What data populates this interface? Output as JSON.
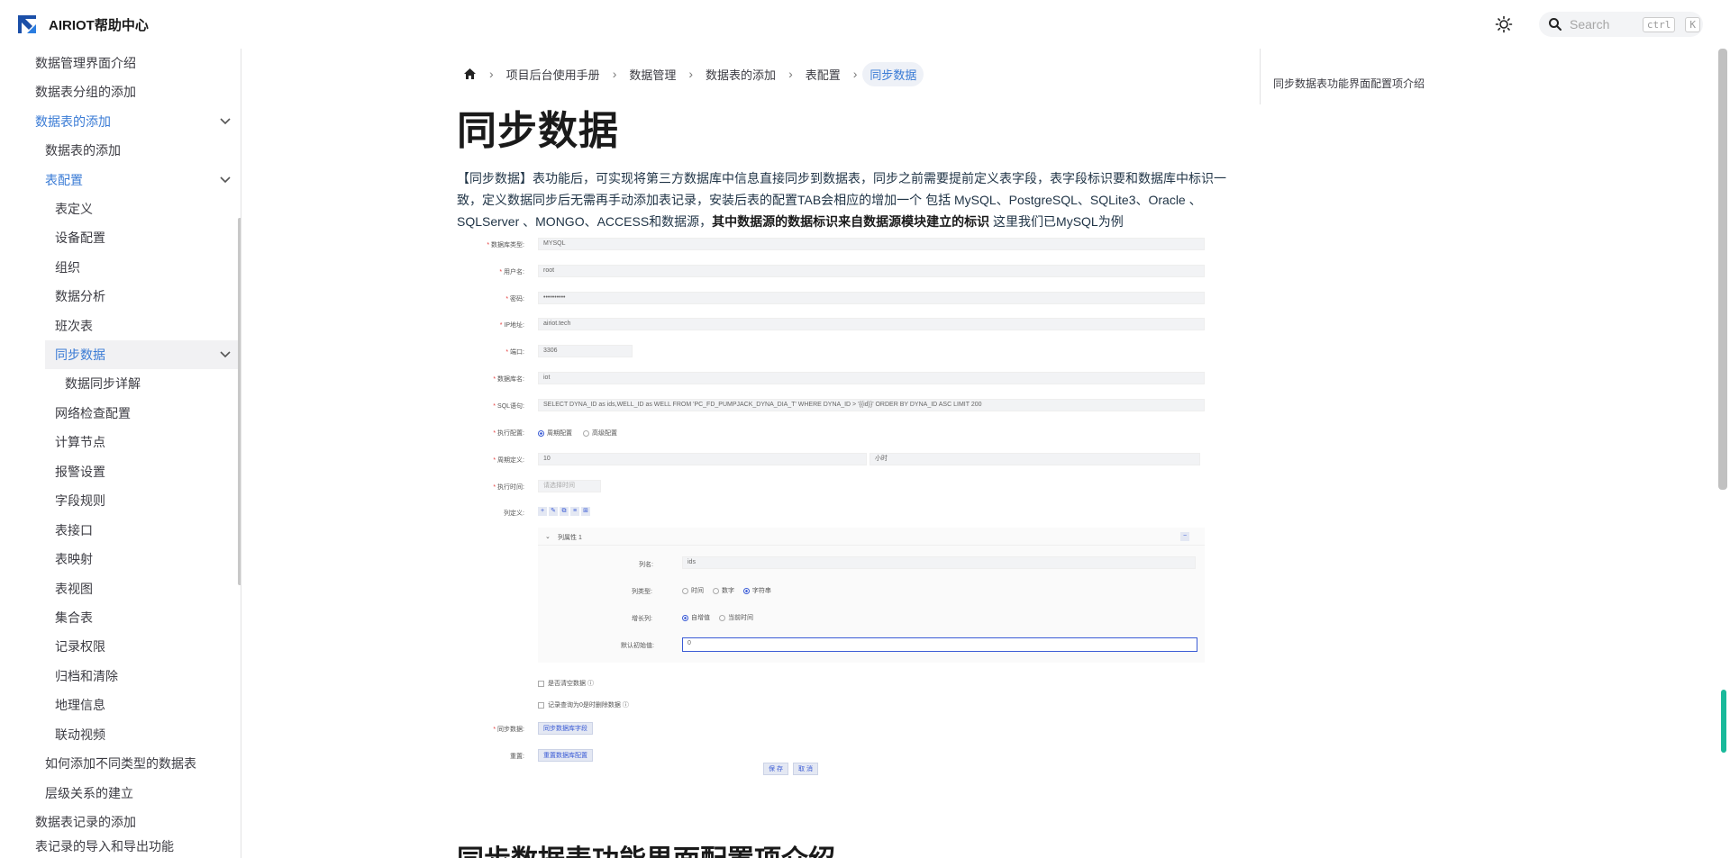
{
  "header": {
    "logo_text": "AIRIOT帮助中心",
    "search_placeholder": "Search",
    "kbd_ctrl": "ctrl",
    "kbd_k": "K"
  },
  "sidebar": {
    "items": [
      {
        "label": "数据管理界面介绍"
      },
      {
        "label": "数据表分组的添加"
      },
      {
        "label": "数据表的添加"
      },
      {
        "label": "数据表的添加"
      },
      {
        "label": "表配置"
      },
      {
        "label": "表定义"
      },
      {
        "label": "设备配置"
      },
      {
        "label": "组织"
      },
      {
        "label": "数据分析"
      },
      {
        "label": "班次表"
      },
      {
        "label": "同步数据"
      },
      {
        "label": "数据同步详解"
      },
      {
        "label": "网络检查配置"
      },
      {
        "label": "计算节点"
      },
      {
        "label": "报警设置"
      },
      {
        "label": "字段规则"
      },
      {
        "label": "表接口"
      },
      {
        "label": "表映射"
      },
      {
        "label": "表视图"
      },
      {
        "label": "集合表"
      },
      {
        "label": "记录权限"
      },
      {
        "label": "归档和清除"
      },
      {
        "label": "地理信息"
      },
      {
        "label": "联动视频"
      },
      {
        "label": "如何添加不同类型的数据表"
      },
      {
        "label": "层级关系的建立"
      },
      {
        "label": "数据表记录的添加"
      },
      {
        "label": "表记录的导入和导出功能"
      }
    ]
  },
  "breadcrumb": [
    "项目后台使用手册",
    "数据管理",
    "数据表的添加",
    "表配置",
    "同步数据"
  ],
  "page": {
    "title": "同步数据",
    "para_1": "【同步数据】表功能后，可实现将第三方数据库中信息直接同步到数据表，同步之前需要提前定义表字段，表字段标识要和数据库中标识一致，定义数据同步后无需再手动添加表记录，安装后表的配置TAB会相应的增加一个 包括 MySQL、PostgreSQL、SQLite3、Oracle 、 SQLServer 、MONGO、ACCESS和数据源，",
    "para_bold": "其中数据源的数据标识来自数据源模块建立的标识",
    "para_2": " 这里我们已MySQL为例",
    "section_title": "同步数据表功能界面配置项介绍"
  },
  "toc": {
    "link": "同步数据表功能界面配置项介绍"
  },
  "form": {
    "db_type_label": "数据库类型",
    "db_type_value": "MYSQL",
    "user_label": "用户名",
    "user_value": "root",
    "pwd_label": "密码",
    "pwd_value": "••••••••••",
    "ip_label": "IP地址",
    "ip_value": "airiot.tech",
    "port_label": "端口",
    "port_value": "3306",
    "dbname_label": "数据库名",
    "dbname_value": "iot",
    "sql_label": "SQL语句",
    "sql_value": "SELECT DYNA_ID as ids,WELL_ID as WELL FROM 'PC_FD_PUMPJACK_DYNA_DIA_T' WHERE DYNA_ID > '{{id}}' ORDER BY DYNA_ID ASC LIMIT 200",
    "exec_label": "执行配置",
    "exec_opt1": "周期配置",
    "exec_opt2": "高级配置",
    "cycle_label": "周期定义",
    "cycle_value": "10",
    "cycle_unit": "小时",
    "exec_time_label": "执行时间",
    "exec_time_placeholder": "请选择时间",
    "cols_label": "列定义",
    "sub_title": "列属性 1",
    "colname_label": "列名",
    "colname_value": "ids",
    "coltype_label": "列类型",
    "coltype_opt1": "时间",
    "coltype_opt2": "数字",
    "coltype_opt3": "字符串",
    "incr_label": "增长列",
    "incr_opt1": "自增值",
    "incr_opt2": "当前时间",
    "default_label": "默认初始值",
    "default_value": "0",
    "chk1": "是否清空数据",
    "chk2": "记录查询为0是时删除数据",
    "sync_label": "同步数据",
    "sync_btn": "同步数据库字段",
    "reset_label": "重置",
    "reset_btn": "重置数据库配置",
    "save_btn": "保 存",
    "cancel_btn": "取 消"
  }
}
